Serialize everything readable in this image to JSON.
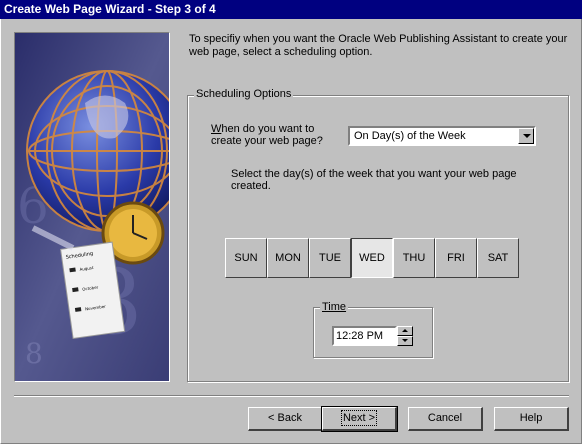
{
  "window": {
    "title": "Create Web Page Wizard - Step 3 of 4"
  },
  "intro_text": "To specifiy when you want the Oracle Web Publishing Assistant to create your web page, select a scheduling option.",
  "scheduling": {
    "group_label": "Scheduling Options",
    "when_label_line1": "When do you want to",
    "when_label_line2": "create your web page?",
    "when_accel": "W",
    "when_value": "On Day(s) of the Week",
    "days_instruction": "Select the day(s) of the week that you want your web page created.",
    "days": [
      {
        "label": "SUN",
        "selected": false
      },
      {
        "label": "MON",
        "selected": false
      },
      {
        "label": "TUE",
        "selected": false
      },
      {
        "label": "WED",
        "selected": true
      },
      {
        "label": "THU",
        "selected": false
      },
      {
        "label": "FRI",
        "selected": false
      },
      {
        "label": "SAT",
        "selected": false
      }
    ],
    "time_label": "Time",
    "time_value": "12:28 PM"
  },
  "art_text": {
    "doc_heading": "Scheduling",
    "doc_lines": [
      "August",
      "October",
      "November"
    ]
  },
  "buttons": {
    "back": "< Back",
    "next": "Next >",
    "cancel": "Cancel",
    "help": "Help"
  },
  "colors": {
    "titlebar": "#000080",
    "face": "#c0c0c0",
    "art_bg": "#3c3f7a"
  }
}
